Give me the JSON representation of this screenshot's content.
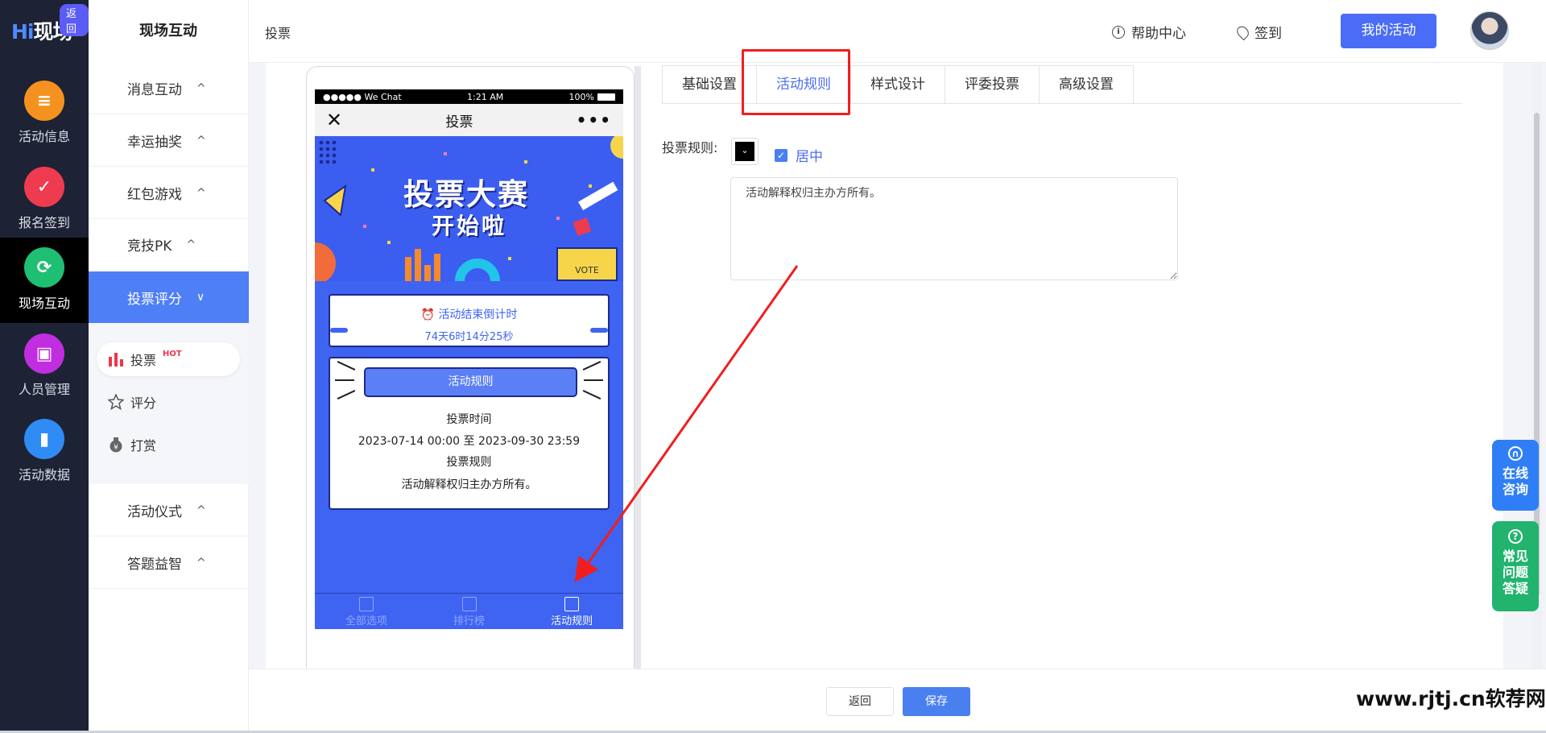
{
  "rail": {
    "logo_hi": "Hi",
    "logo_rest": "现场",
    "return_badge": "返回",
    "items": [
      {
        "label": "活动信息",
        "icon": "document-icon",
        "color": "#f5921f"
      },
      {
        "label": "报名签到",
        "icon": "calendar-check-icon",
        "color": "#ef3b4f"
      },
      {
        "label": "现场互动",
        "icon": "interaction-icon",
        "color": "#1fbf73"
      },
      {
        "label": "人员管理",
        "icon": "person-card-icon",
        "color": "#c02ee0"
      },
      {
        "label": "活动数据",
        "icon": "bar-chart-icon",
        "color": "#2f8cf5"
      }
    ],
    "active_index": 2
  },
  "sidebar": {
    "title": "现场互动",
    "menus": [
      {
        "label": "消息互动",
        "chevron": "^"
      },
      {
        "label": "幸运抽奖",
        "chevron": "^"
      },
      {
        "label": "红包游戏",
        "chevron": "^"
      },
      {
        "label": "竞技PK",
        "chevron": "^"
      },
      {
        "label": "投票评分",
        "chevron": "∨"
      },
      {
        "label": "活动仪式",
        "chevron": "^"
      },
      {
        "label": "答题益智",
        "chevron": "^"
      }
    ],
    "submenu": [
      {
        "label": "投票",
        "badge": "HOT",
        "icon": "bar-chart-icon"
      },
      {
        "label": "评分",
        "icon": "star-icon"
      },
      {
        "label": "打赏",
        "icon": "money-bag-icon"
      }
    ]
  },
  "topbar": {
    "breadcrumb": "投票",
    "help": "帮助中心",
    "checkin": "签到",
    "my_activity": "我的活动"
  },
  "phone": {
    "status_left": "●●●●● We Chat",
    "status_time": "1:21 AM",
    "status_battery": "100%",
    "nav_close": "✕",
    "nav_title": "投票",
    "nav_more": "•••",
    "banner_line1": "投票大赛",
    "banner_line2": "开始啦",
    "vote_box": "VOTE",
    "countdown_title": "活动结束倒计时",
    "countdown_time": "74天6时14分25秒",
    "rules_button": "活动规则",
    "vote_time_label": "投票时间",
    "vote_time_range": "2023-07-14 00:00 至 2023-09-30 23:59",
    "vote_rules_label": "投票规则",
    "vote_rules_text": "活动解释权归主办方所有。",
    "tabs": [
      "全部选项",
      "排行榜",
      "活动规则"
    ],
    "active_tab": 2
  },
  "settings": {
    "tabs": [
      "基础设置",
      "活动规则",
      "样式设计",
      "评委投票",
      "高级设置"
    ],
    "active_tab": 1,
    "rule_label": "投票规则:",
    "center_label": "居中",
    "center_checked": true,
    "rule_text": "活动解释权归主办方所有。",
    "text_color": "#000000",
    "highlight_color": "#f11e1e"
  },
  "float_buttons": [
    {
      "label": "在线咨询",
      "color": "#2f7ef5",
      "icon": "headset-icon"
    },
    {
      "label": "常见问题答疑",
      "color": "#22b46e",
      "icon": "question-icon"
    }
  ],
  "footer": {
    "back": "返回",
    "save": "保存"
  },
  "watermark": "www.rjtj.cn软荐网"
}
